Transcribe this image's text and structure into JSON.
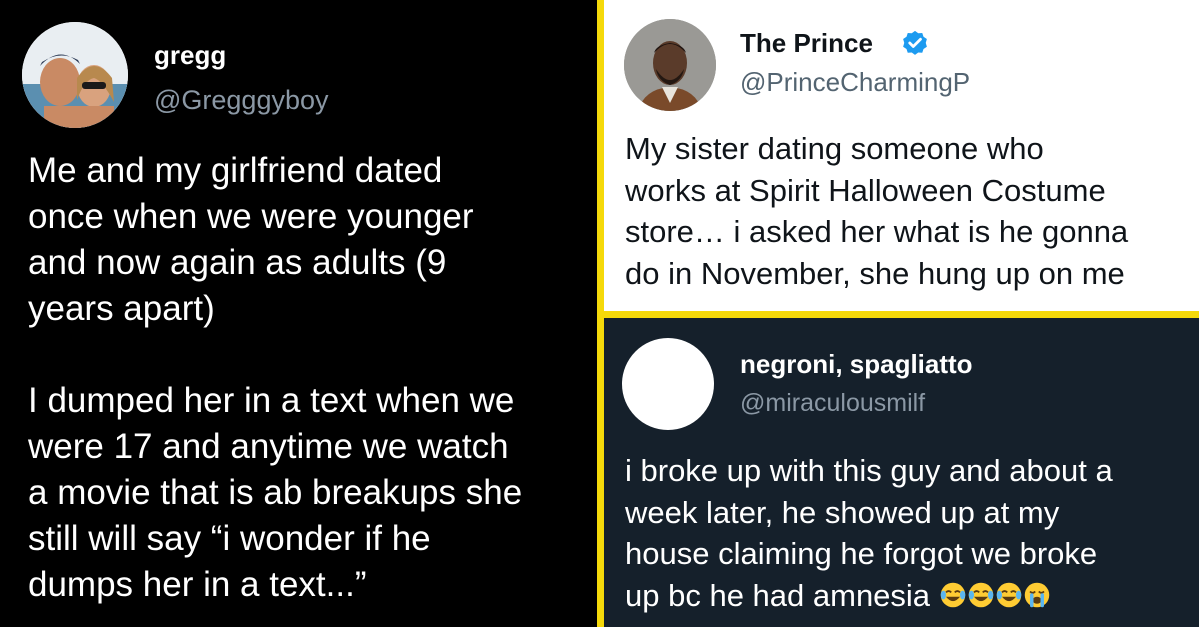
{
  "tweets": [
    {
      "name": "gregg",
      "handle": "@Gregggyboy",
      "text": "Me and my girlfriend dated\nonce when we were younger\nand now again as adults (9\nyears apart)\n\nI dumped her in a text when we\nwere 17 and anytime we watch\na movie that is ab breakups she\nstill will say “i wonder if he\ndumps her in a text...”",
      "theme": "black"
    },
    {
      "name": "The Prince",
      "handle": "@PrinceCharmingP",
      "verified": true,
      "text": "My sister dating someone who\nworks at Spirit Halloween Costume\nstore… i asked her what is he gonna\ndo in November, she hung up on me",
      "theme": "light"
    },
    {
      "name": "negroni, spagliatto",
      "handle": "@miraculousmilf",
      "text": "i broke up with this guy and about a\nweek later, he showed up at my\nhouse claiming he forgot we broke\nup bc he had amnesia",
      "emojis": [
        "tears-of-joy-emoji",
        "tears-of-joy-emoji",
        "tears-of-joy-emoji",
        "loudly-crying-emoji"
      ],
      "theme": "dim"
    }
  ],
  "colors": {
    "background": "#f5d90a",
    "verified_blue": "#1d9bf0",
    "dim_panel": "#15202b",
    "handle_gray_dark": "#8b98a5",
    "handle_gray_light": "#536471"
  }
}
